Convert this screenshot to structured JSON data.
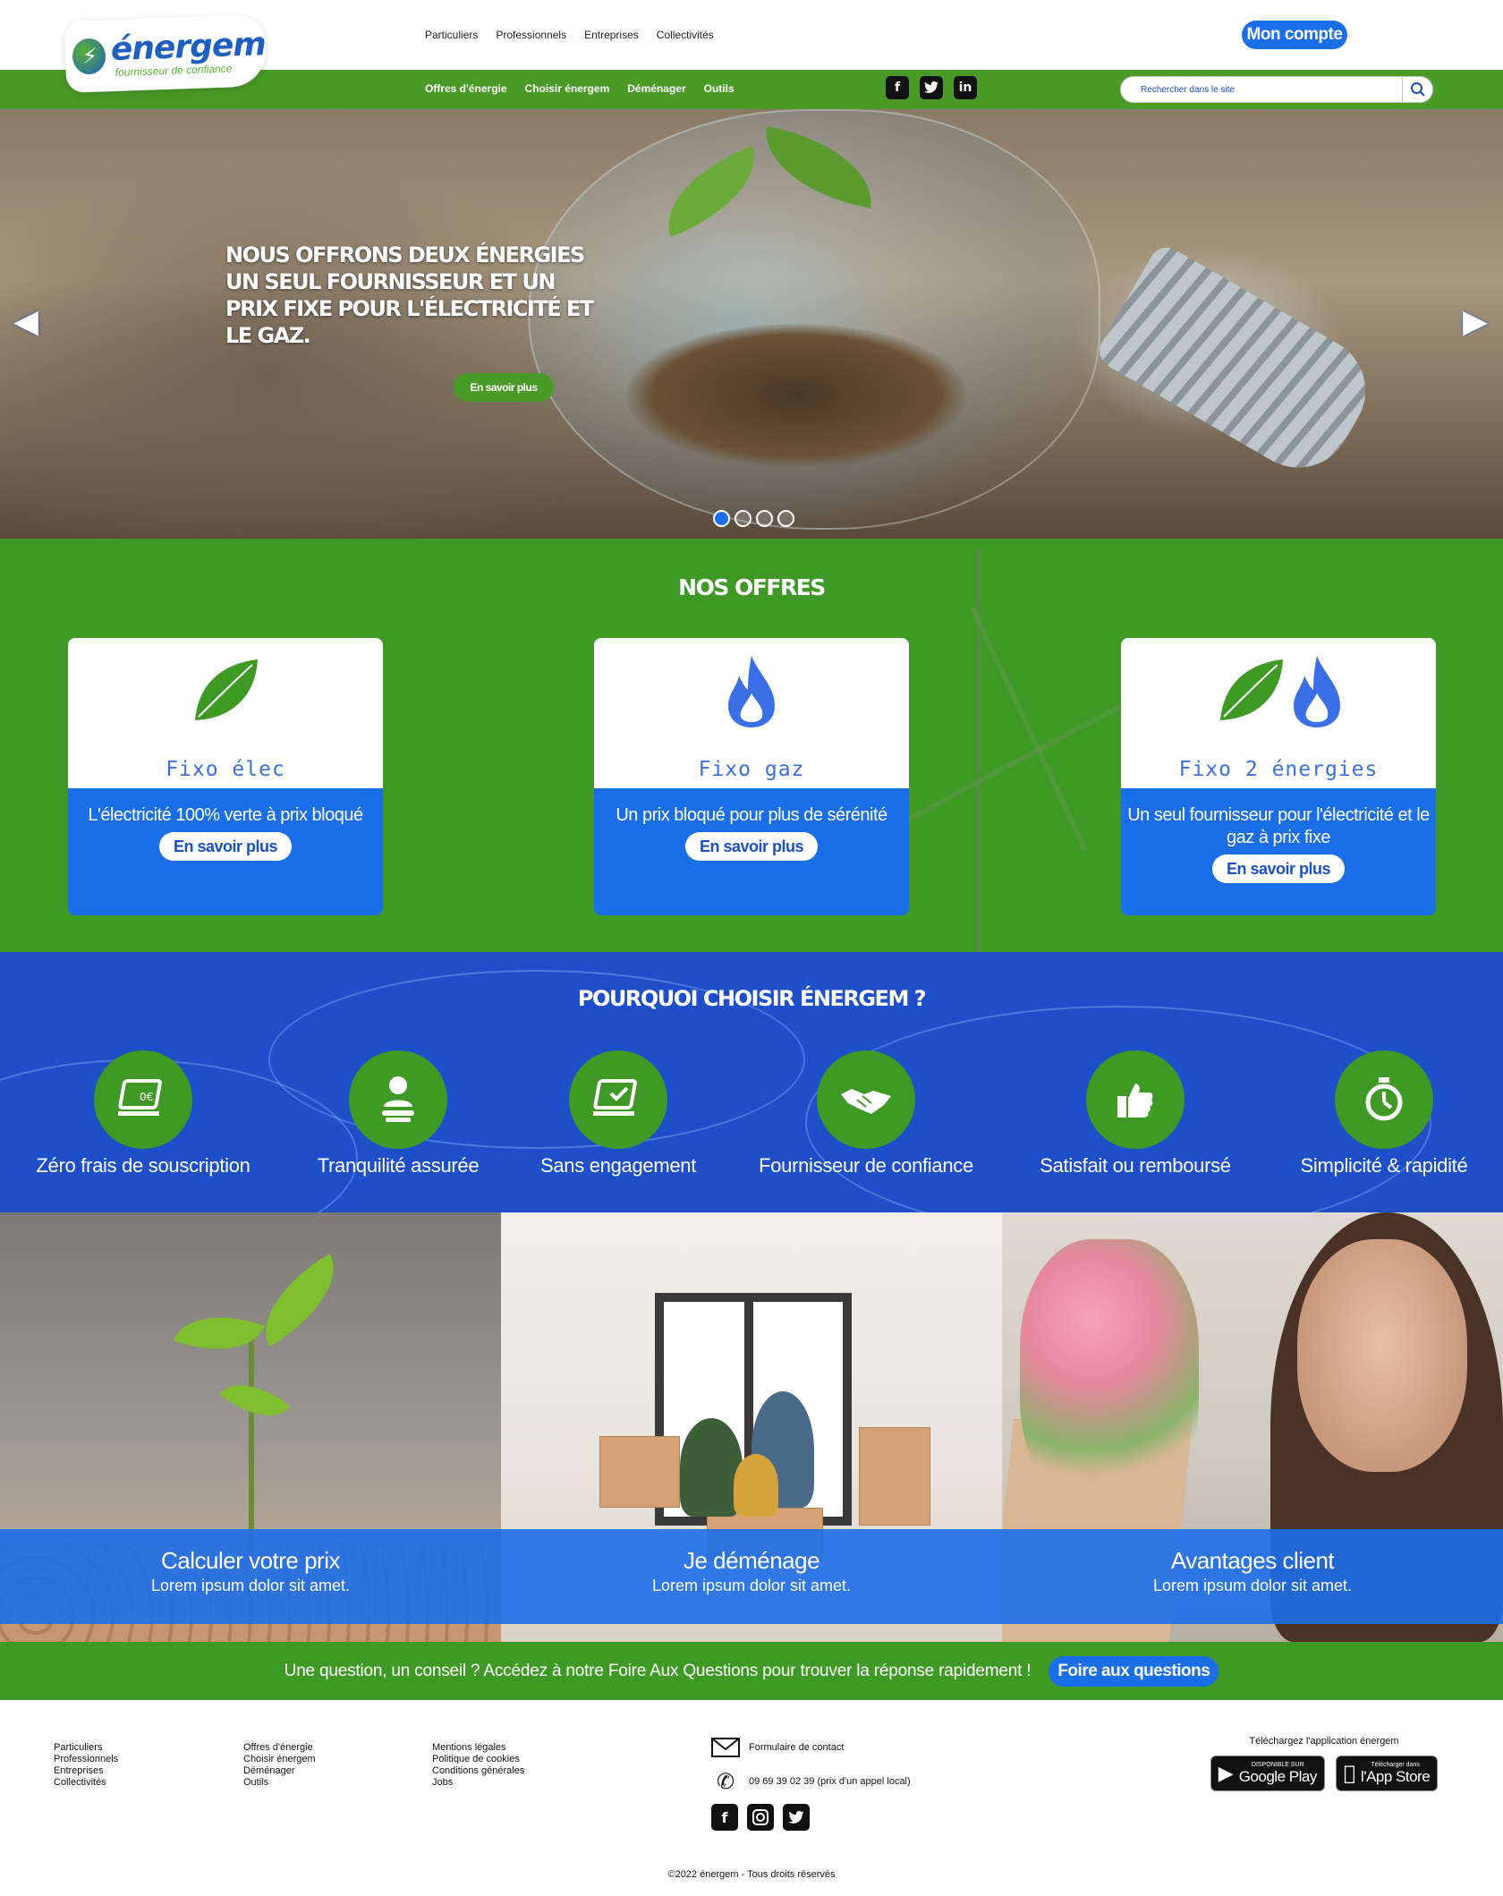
{
  "header": {
    "logo": {
      "name": "énergem",
      "tagline": "fournisseur de confiance"
    },
    "top_nav": [
      "Particuliers",
      "Professionnels",
      "Entreprises",
      "Collectivités"
    ],
    "account_button": "Mon compte",
    "main_nav": [
      "Offres d'énergie",
      "Choisir énergem",
      "Déménager",
      "Outils"
    ],
    "social": [
      "facebook-icon",
      "twitter-icon",
      "linkedin-icon"
    ],
    "search": {
      "placeholder": "Rechercher dans le site",
      "value": ""
    }
  },
  "hero": {
    "title": "NOUS OFFRONS DEUX ÉNERGIES UN SEUL FOURNISSEUR ET UN PRIX FIXE POUR L'ÉLECTRICITÉ ET LE GAZ.",
    "button": "En savoir plus",
    "slides": 4,
    "active_slide": 1
  },
  "offres": {
    "title": "NOS OFFRES",
    "cards": [
      {
        "name": "Fixo élec",
        "description": "L'électricité 100% verte à prix bloqué",
        "button": "En savoir plus",
        "icons": [
          "leaf-icon"
        ]
      },
      {
        "name": "Fixo gaz",
        "description": "Un prix bloqué pour plus de sérénité",
        "button": "En savoir plus",
        "icons": [
          "flame-icon"
        ]
      },
      {
        "name": "Fixo 2 énergies",
        "description": "Un seul fournisseur pour l'électricité et le gaz à prix fixe",
        "button": "En savoir plus",
        "icons": [
          "leaf-icon",
          "flame-icon"
        ]
      }
    ]
  },
  "pourquoi": {
    "title": "POURQUOI CHOISIR ÉNERGEM ?",
    "items": [
      {
        "label": "Zéro frais de souscription",
        "icon": "laptop-euro-icon"
      },
      {
        "label": "Tranquilité assurée",
        "icon": "person-relax-icon"
      },
      {
        "label": "Sans engagement",
        "icon": "laptop-check-icon"
      },
      {
        "label": "Fournisseur de confiance",
        "icon": "handshake-icon"
      },
      {
        "label": "Satisfait ou remboursé",
        "icon": "thumbs-up-icon"
      },
      {
        "label": "Simplicité & rapidité",
        "icon": "stopwatch-icon"
      }
    ]
  },
  "tiles": [
    {
      "title": "Calculer votre prix",
      "subtitle": "Lorem ipsum dolor sit amet."
    },
    {
      "title": "Je déménage",
      "subtitle": "Lorem ipsum dolor sit amet."
    },
    {
      "title": "Avantages client",
      "subtitle": "Lorem ipsum dolor sit amet."
    }
  ],
  "faq": {
    "text": "Une question, un conseil ? Accédez à notre Foire Aux Questions pour trouver la réponse rapidement !",
    "button": "Foire aux questions"
  },
  "footer": {
    "col1": [
      "Particuliers",
      "Professionnels",
      "Entreprises",
      "Collectivités"
    ],
    "col2": [
      "Offres d'énergie",
      "Choisir énergem",
      "Déménager",
      "Outils"
    ],
    "col3": [
      "Mentions légales",
      "Politique de cookies",
      "Conditions générales",
      "Jobs"
    ],
    "contact_form": "Formulaire de contact",
    "phone": "09 69 39 02 39 (prix d'un appel local)",
    "social": [
      "facebook-icon",
      "instagram-icon",
      "twitter-icon"
    ],
    "app_text": "Téléchargez l'application énergem",
    "google_play": {
      "small": "DISPONIBLE SUR",
      "large": "Google Play"
    },
    "app_store": {
      "small": "Télécharger dans",
      "large": "l'App Store"
    },
    "copyright": "©2022 énergem - Tous droits réservés"
  },
  "colors": {
    "green": "#3f9a25",
    "blue": "#1a6ee8",
    "dark_blue": "#1e4fc9"
  }
}
